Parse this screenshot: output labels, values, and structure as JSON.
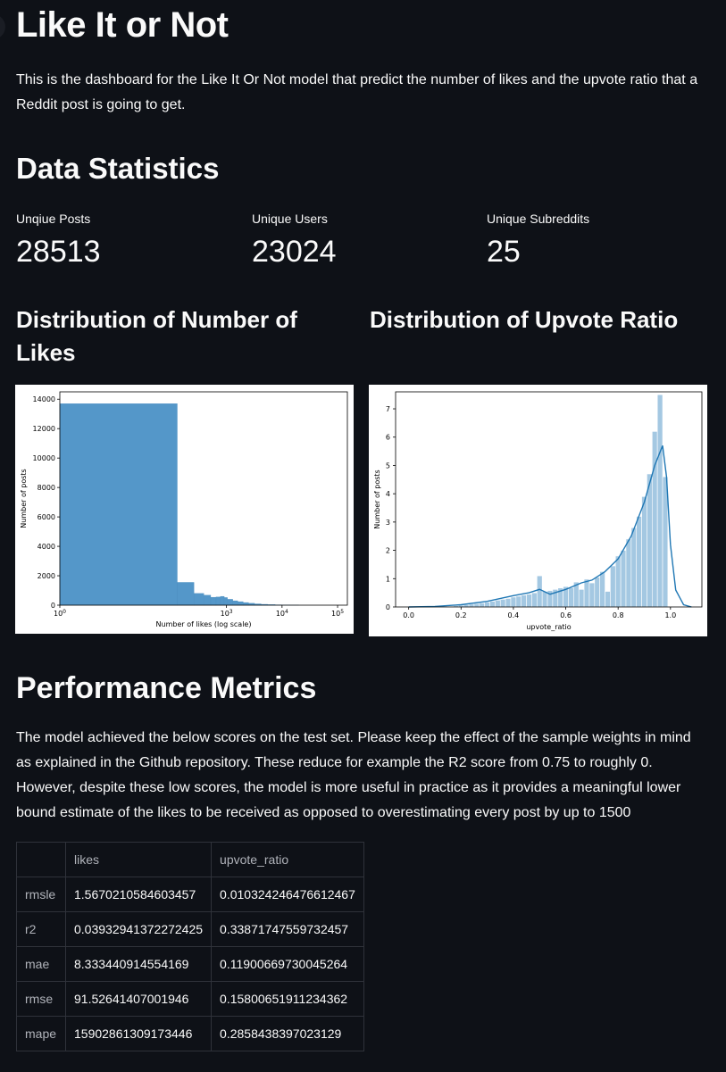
{
  "title": "Like It or Not",
  "intro": "This is the dashboard for the Like It Or Not model that predict the number of likes and the upvote ratio that a Reddit post is going to get.",
  "stats": {
    "heading": "Data Statistics",
    "metrics": [
      {
        "label": "Unqiue Posts",
        "value": "28513"
      },
      {
        "label": "Unique Users",
        "value": "23024"
      },
      {
        "label": "Unique Subreddits",
        "value": "25"
      }
    ]
  },
  "charts": {
    "likes_heading": "Distribution of Number of Likes",
    "ratio_heading": "Distribution of Upvote Ratio"
  },
  "chart_data": [
    {
      "type": "bar",
      "title": "",
      "xlabel": "Number of likes (log scale)",
      "ylabel": "Number of posts",
      "x_scale": "log",
      "ylim": [
        0,
        14500
      ],
      "xlim": [
        1,
        150000
      ],
      "x_ticks": [
        "10^0",
        "10^3",
        "10^4",
        "10^5"
      ],
      "y_ticks": [
        0,
        2000,
        4000,
        6000,
        8000,
        10000,
        12000,
        14000
      ],
      "bins": [
        {
          "x0": 1,
          "x1": 130,
          "value": 13700
        },
        {
          "x0": 130,
          "x1": 260,
          "value": 1550
        },
        {
          "x0": 260,
          "x1": 390,
          "value": 800
        },
        {
          "x0": 390,
          "x1": 520,
          "value": 680
        },
        {
          "x0": 520,
          "x1": 650,
          "value": 540
        },
        {
          "x0": 650,
          "x1": 780,
          "value": 560
        },
        {
          "x0": 780,
          "x1": 910,
          "value": 600
        },
        {
          "x0": 910,
          "x1": 1040,
          "value": 520
        },
        {
          "x0": 1040,
          "x1": 1300,
          "value": 400
        },
        {
          "x0": 1300,
          "x1": 1600,
          "value": 300
        },
        {
          "x0": 1600,
          "x1": 2000,
          "value": 240
        },
        {
          "x0": 2000,
          "x1": 2500,
          "value": 180
        },
        {
          "x0": 2500,
          "x1": 3200,
          "value": 130
        },
        {
          "x0": 3200,
          "x1": 4200,
          "value": 90
        },
        {
          "x0": 4200,
          "x1": 5500,
          "value": 60
        },
        {
          "x0": 5500,
          "x1": 7500,
          "value": 40
        },
        {
          "x0": 7500,
          "x1": 10000,
          "value": 25
        },
        {
          "x0": 10000,
          "x1": 14000,
          "value": 15
        },
        {
          "x0": 14000,
          "x1": 20000,
          "value": 8
        }
      ]
    },
    {
      "type": "bar",
      "title": "",
      "xlabel": "upvote_ratio",
      "ylabel": "Number of posts",
      "xlim": [
        -0.05,
        1.12
      ],
      "ylim": [
        0,
        7.6
      ],
      "x_ticks": [
        "0.0",
        "0.2",
        "0.4",
        "0.6",
        "0.8",
        "1.0"
      ],
      "y_ticks": [
        0,
        1,
        2,
        3,
        4,
        5,
        6,
        7
      ],
      "bin_width": 0.02,
      "bins": [
        {
          "x": 0.12,
          "value": 0.02
        },
        {
          "x": 0.14,
          "value": 0.03
        },
        {
          "x": 0.16,
          "value": 0.03
        },
        {
          "x": 0.18,
          "value": 0.04
        },
        {
          "x": 0.2,
          "value": 0.06
        },
        {
          "x": 0.22,
          "value": 0.08
        },
        {
          "x": 0.24,
          "value": 0.1
        },
        {
          "x": 0.26,
          "value": 0.12
        },
        {
          "x": 0.28,
          "value": 0.14
        },
        {
          "x": 0.3,
          "value": 0.17
        },
        {
          "x": 0.32,
          "value": 0.2
        },
        {
          "x": 0.34,
          "value": 0.24
        },
        {
          "x": 0.36,
          "value": 0.27
        },
        {
          "x": 0.38,
          "value": 0.3
        },
        {
          "x": 0.4,
          "value": 0.35
        },
        {
          "x": 0.42,
          "value": 0.38
        },
        {
          "x": 0.44,
          "value": 0.42
        },
        {
          "x": 0.46,
          "value": 0.45
        },
        {
          "x": 0.48,
          "value": 0.5
        },
        {
          "x": 0.5,
          "value": 1.1
        },
        {
          "x": 0.52,
          "value": 0.55
        },
        {
          "x": 0.54,
          "value": 0.58
        },
        {
          "x": 0.56,
          "value": 0.62
        },
        {
          "x": 0.58,
          "value": 0.67
        },
        {
          "x": 0.6,
          "value": 0.72
        },
        {
          "x": 0.62,
          "value": 0.68
        },
        {
          "x": 0.64,
          "value": 0.88
        },
        {
          "x": 0.66,
          "value": 0.62
        },
        {
          "x": 0.68,
          "value": 0.98
        },
        {
          "x": 0.7,
          "value": 0.85
        },
        {
          "x": 0.72,
          "value": 1.05
        },
        {
          "x": 0.74,
          "value": 1.25
        },
        {
          "x": 0.76,
          "value": 0.55
        },
        {
          "x": 0.78,
          "value": 1.45
        },
        {
          "x": 0.8,
          "value": 1.8
        },
        {
          "x": 0.82,
          "value": 2.0
        },
        {
          "x": 0.84,
          "value": 2.4
        },
        {
          "x": 0.86,
          "value": 2.8
        },
        {
          "x": 0.88,
          "value": 3.2
        },
        {
          "x": 0.9,
          "value": 3.9
        },
        {
          "x": 0.92,
          "value": 4.7
        },
        {
          "x": 0.94,
          "value": 6.2
        },
        {
          "x": 0.96,
          "value": 7.5
        },
        {
          "x": 0.98,
          "value": 4.6
        }
      ],
      "kde": [
        [
          0.0,
          0.0
        ],
        [
          0.1,
          0.02
        ],
        [
          0.2,
          0.08
        ],
        [
          0.3,
          0.2
        ],
        [
          0.4,
          0.4
        ],
        [
          0.46,
          0.5
        ],
        [
          0.5,
          0.62
        ],
        [
          0.54,
          0.45
        ],
        [
          0.6,
          0.62
        ],
        [
          0.66,
          0.85
        ],
        [
          0.7,
          0.95
        ],
        [
          0.75,
          1.25
        ],
        [
          0.8,
          1.7
        ],
        [
          0.85,
          2.5
        ],
        [
          0.9,
          3.7
        ],
        [
          0.94,
          5.0
        ],
        [
          0.97,
          5.7
        ],
        [
          0.985,
          4.6
        ],
        [
          1.0,
          2.2
        ],
        [
          1.02,
          0.6
        ],
        [
          1.05,
          0.08
        ],
        [
          1.08,
          0.0
        ]
      ]
    }
  ],
  "performance": {
    "heading": "Performance Metrics",
    "text": "The model achieved the below scores on the test set. Please keep the effect of the sample weights in mind as explained in the Github repository. These reduce for example the R2 score from 0.75 to roughly 0. However, despite these low scores, the model is more useful in practice as it provides a meaningful lower bound estimate of the likes to be received as opposed to overestimating every post by up to 1500",
    "columns": [
      "",
      "likes",
      "upvote_ratio"
    ],
    "rows": [
      {
        "name": "rmsle",
        "likes": "1.5670210584603457",
        "upvote_ratio": "0.010324246476612467"
      },
      {
        "name": "r2",
        "likes": "0.03932941372272425",
        "upvote_ratio": "0.33871747559732457"
      },
      {
        "name": "mae",
        "likes": "8.333440914554169",
        "upvote_ratio": "0.11900669730045264"
      },
      {
        "name": "rmse",
        "likes": "91.52641407001946",
        "upvote_ratio": "0.15800651911234362"
      },
      {
        "name": "mape",
        "likes": "15902861309173446",
        "upvote_ratio": "0.2858438397023129"
      }
    ]
  }
}
